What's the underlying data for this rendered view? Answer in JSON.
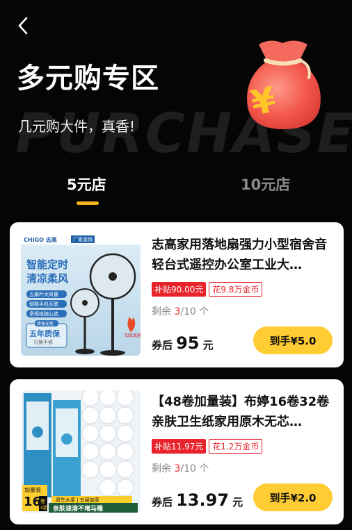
{
  "header": {
    "title": "多元购专区",
    "subtitle": "几元购大件，真香!",
    "watermark": "PURCHASE",
    "back_icon": "chevron-left-icon",
    "bag_icon": "money-bag-yen-icon"
  },
  "tabs": [
    {
      "label": "5元店",
      "active": true
    },
    {
      "label": "10元店",
      "active": false
    }
  ],
  "products": [
    {
      "title": "志高家用落地扇强力小型宿舍音轻台式遥控办公室工业大…",
      "subsidy": "补贴90.00元",
      "coins": "花9.8万金币",
      "remain_label": "剩余",
      "remain_num": "3",
      "remain_total": "/10 个",
      "price_prefix": "券后",
      "price": "95",
      "price_unit": "元",
      "button": "到手¥5.0",
      "image_text": {
        "brand": "CHIGO 志高",
        "badge": "厂家直销",
        "headline1": "智能定时",
        "headline2": "清凉柔风",
        "feature1": "五扇叶大风量",
        "feature2": "智能手机互联",
        "feature3": "多规格随心选",
        "warranty_small": "质保无忧",
        "warranty": "五年质保",
        "warranty_sub": "只换不修",
        "fire": "加厚底座"
      }
    },
    {
      "title": "【48卷加量装】布婷16卷32卷亲肤卫生纸家用原木无芯…",
      "subsidy": "补贴11.97元",
      "coins": "花1.2万金币",
      "remain_label": "剩余",
      "remain_num": "3",
      "remain_total": "/10 个",
      "price_prefix": "券后",
      "price": "13.97",
      "price_unit": "元",
      "button": "到手¥2.0",
      "image_text": {
        "pack_top": "加量装",
        "pack_num": "16",
        "pack_unit": "卷",
        "pack_sub": "4提",
        "ribbon_top": "原生木浆 | 五层加厚",
        "ribbon": "亲肤速溶不堵马桶"
      }
    }
  ],
  "colors": {
    "accent_yellow": "#ffcc33",
    "tab_underline": "#f6b21a",
    "subsidy_red": "#e8232a",
    "background": "#050505"
  }
}
